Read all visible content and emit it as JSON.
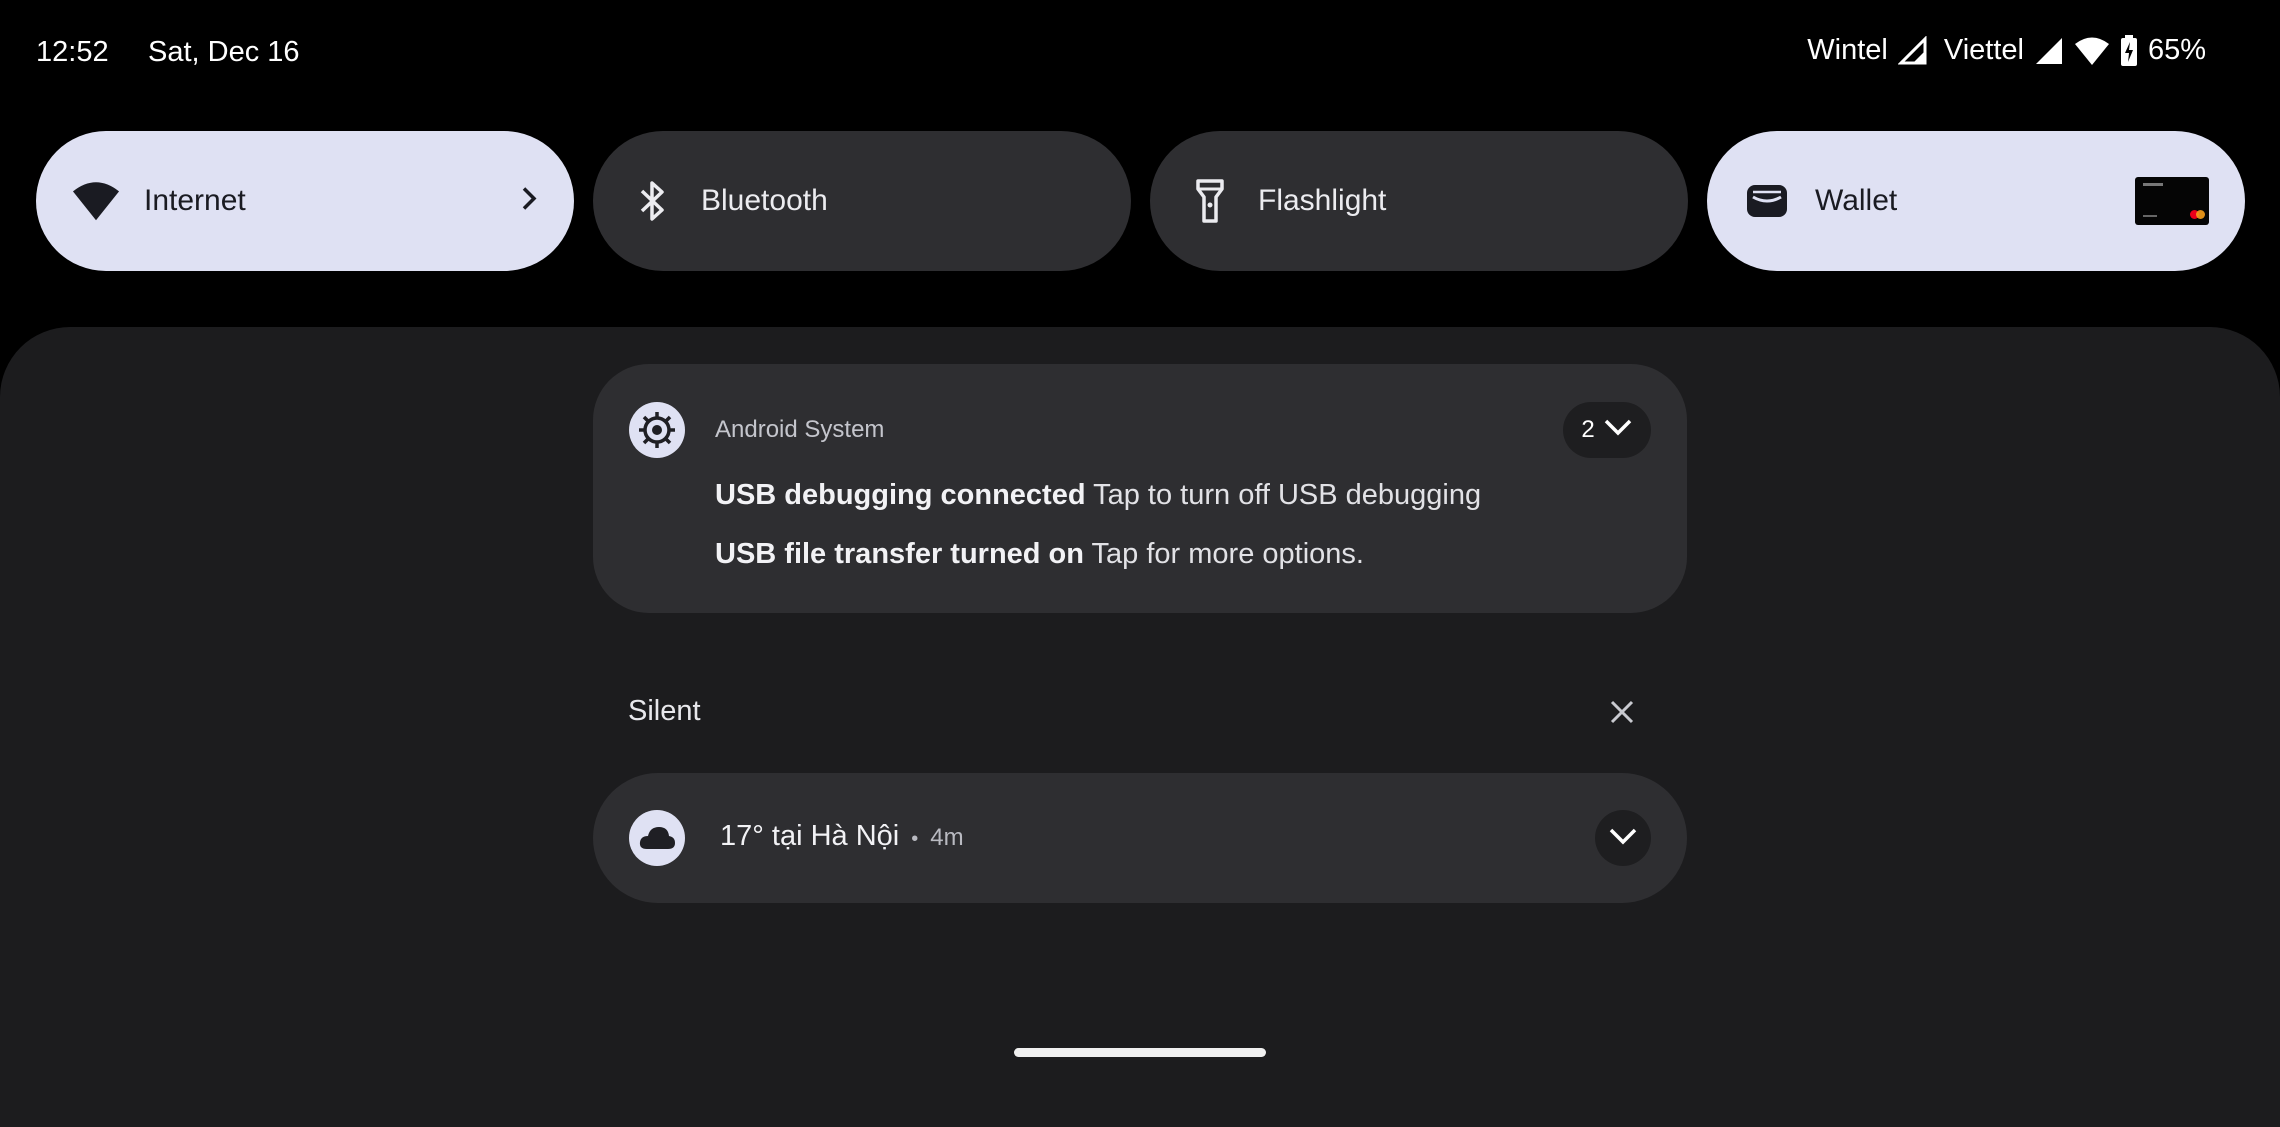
{
  "status_bar": {
    "time": "12:52",
    "date": "Sat, Dec 16",
    "carrier1": "Wintel",
    "carrier2": "Viettel",
    "battery": "65%",
    "icons": [
      "signal-outline-icon",
      "signal-full-icon",
      "wifi-icon",
      "battery-charging-icon"
    ]
  },
  "quick_tiles": [
    {
      "label": "Internet",
      "icon": "wifi-icon",
      "state": "on"
    },
    {
      "label": "Bluetooth",
      "icon": "bluetooth-icon",
      "state": "off"
    },
    {
      "label": "Flashlight",
      "icon": "flashlight-icon",
      "state": "off"
    },
    {
      "label": "Wallet",
      "icon": "wallet-icon",
      "state": "on"
    }
  ],
  "notifications": {
    "system": {
      "app_name": "Android System",
      "count": "2",
      "items": [
        {
          "title": "USB debugging connected",
          "text": "Tap to turn off USB debugging"
        },
        {
          "title": "USB file transfer turned on",
          "text": "Tap for more options."
        }
      ]
    },
    "silent_section": {
      "header": "Silent"
    },
    "weather": {
      "title": "17° tại Hà Nội",
      "separator": "•",
      "time": "4m"
    }
  },
  "colors": {
    "tile_on": "#dfe1f3",
    "tile_off": "#2e2e31",
    "shade_bg": "#1c1c1e",
    "card_bg": "#2e2e31"
  }
}
